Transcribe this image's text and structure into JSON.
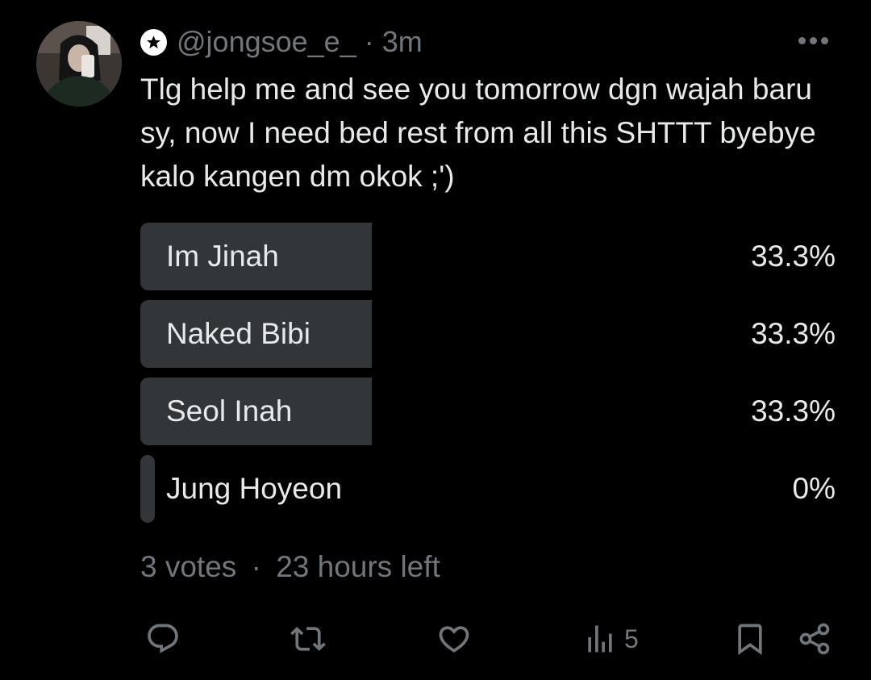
{
  "tweet": {
    "handle": "@jongsoe_e_",
    "separator": "·",
    "time": "3m",
    "text": "Tlg help me and see you tomorrow dgn wajah baru sy, now I need bed rest from all this SHTTT byebye kalo kangen dm okok ;')"
  },
  "poll": {
    "options": [
      {
        "label": "Im Jinah",
        "percent_text": "33.3%",
        "share": 0.333
      },
      {
        "label": "Naked Bibi",
        "percent_text": "33.3%",
        "share": 0.333
      },
      {
        "label": "Seol Inah",
        "percent_text": "33.3%",
        "share": 0.333
      },
      {
        "label": "Jung Hoyeon",
        "percent_text": "0%",
        "share": 0
      }
    ],
    "votes": "3 votes",
    "separator": "·",
    "time_left": "23 hours left"
  },
  "actions": {
    "views_count": "5"
  },
  "icons": {
    "badge": "star-badge-icon",
    "more": "more-dots-icon",
    "reply": "reply-icon",
    "retweet": "retweet-icon",
    "like": "heart-icon",
    "views": "views-bar-chart-icon",
    "bookmark": "bookmark-icon",
    "share": "share-icon"
  },
  "colors": {
    "background": "#000000",
    "text": "#e7e9ea",
    "muted": "#71767b",
    "poll_bar": "#333639"
  }
}
